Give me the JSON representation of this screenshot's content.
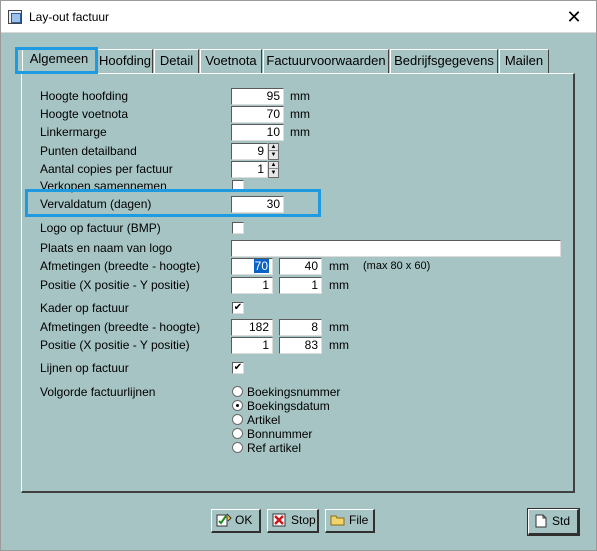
{
  "window": {
    "title": "Lay-out factuur",
    "close_glyph": "✕"
  },
  "tabs": [
    {
      "label": "Algemeen",
      "active": true
    },
    {
      "label": "Hoofding",
      "active": false
    },
    {
      "label": "Detail",
      "active": false
    },
    {
      "label": "Voetnota",
      "active": false
    },
    {
      "label": "Factuurvoorwaarden",
      "active": false
    },
    {
      "label": "Bedrijfsgegevens",
      "active": false
    },
    {
      "label": "Mailen",
      "active": false
    }
  ],
  "form": {
    "hoogte_hoofding": {
      "label": "Hoogte hoofding",
      "value": "95",
      "unit": "mm"
    },
    "hoogte_voetnota": {
      "label": "Hoogte voetnota",
      "value": "70",
      "unit": "mm"
    },
    "linkermarge": {
      "label": "Linkermarge",
      "value": "10",
      "unit": "mm"
    },
    "punten_detailband": {
      "label": "Punten detailband",
      "value": "9"
    },
    "aantal_copies": {
      "label": "Aantal copies per factuur",
      "value": "1"
    },
    "verkopen_samennemen": {
      "label": "Verkopen samennemen",
      "checked": false
    },
    "vervaldatum": {
      "label": "Vervaldatum (dagen)",
      "value": "30"
    },
    "logo_op_factuur": {
      "label": "Logo op factuur (BMP)",
      "checked": false
    },
    "plaats_logo": {
      "label": "Plaats en naam van logo",
      "value": ""
    },
    "logo_afmetingen": {
      "label": "Afmetingen (breedte - hoogte)",
      "breedte": "70",
      "hoogte": "40",
      "unit": "mm",
      "hint": "(max 80 x 60)"
    },
    "logo_positie": {
      "label": "Positie (X positie - Y positie)",
      "x": "1",
      "y": "1",
      "unit": "mm"
    },
    "kader_op_factuur": {
      "label": "Kader op factuur",
      "checked": true
    },
    "kader_afmetingen": {
      "label": "Afmetingen (breedte - hoogte)",
      "breedte": "182",
      "hoogte": "8",
      "unit": "mm"
    },
    "kader_positie": {
      "label": "Positie (X positie - Y positie)",
      "x": "1",
      "y": "83",
      "unit": "mm"
    },
    "lijnen_op_factuur": {
      "label": "Lijnen op factuur",
      "checked": true
    },
    "volgorde": {
      "label": "Volgorde factuurlijnen",
      "options": [
        {
          "label": "Boekingsnummer",
          "selected": false
        },
        {
          "label": "Boekingsdatum",
          "selected": true
        },
        {
          "label": "Artikel",
          "selected": false
        },
        {
          "label": "Bonnummer",
          "selected": false
        },
        {
          "label": "Ref artikel",
          "selected": false
        }
      ]
    }
  },
  "buttons": {
    "ok": "OK",
    "stop": "Stop",
    "file": "File",
    "std": "Std"
  },
  "colors": {
    "background": "#a7c4c4",
    "highlight": "#1e9be0",
    "selection": "#0a64c8"
  },
  "icons": {
    "app": "layout-window-icon",
    "ok": "check-pen-icon",
    "stop": "red-x-icon",
    "file": "folder-icon",
    "std": "document-icon"
  }
}
